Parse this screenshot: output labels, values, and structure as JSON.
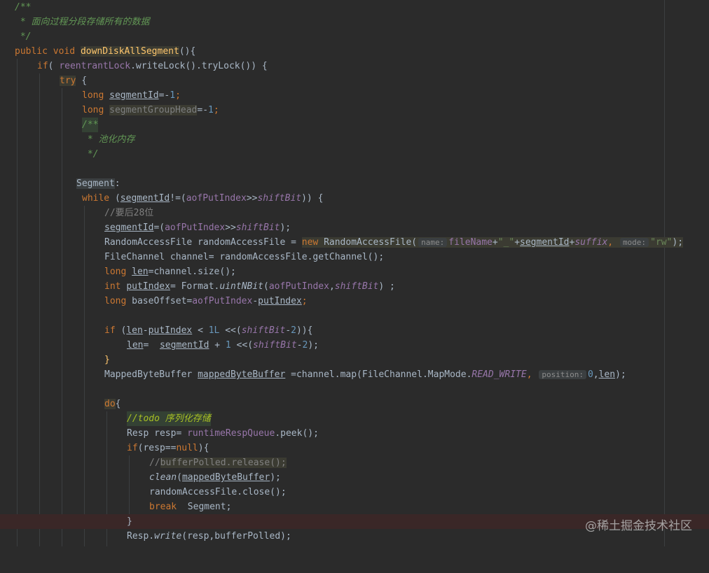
{
  "lines": {
    "l1": "/**",
    "l2": " * 面向过程分段存储所有的数据",
    "l3": " */",
    "l4_kw1": "public",
    "l4_kw2": "void",
    "l4_fn": "downDiskAllSegment",
    "l4_rest": "(){",
    "l5_kw": "if",
    "l5_a": "( ",
    "l5_field": "reentrantLock",
    "l5_b": ".writeLock().tryLock()) {",
    "l6_kw": "try",
    "l6_b": " {",
    "l7_kw": "long",
    "l7_var": "segmentId",
    "l7_eq": "=-",
    "l7_num": "1",
    "l7_end": ";",
    "l8_kw": "long",
    "l8_var": "segmentGroupHead",
    "l8_eq": "=-",
    "l8_num": "1",
    "l8_end": ";",
    "l9": "/**",
    "l10": " * 池化内存",
    "l11": " */",
    "l13_label": "Segment",
    "l13_colon": ":",
    "l14_kw": "while",
    "l14_a": " (",
    "l14_var": "segmentId",
    "l14_b": "!=(",
    "l14_field": "aofPutIndex",
    "l14_c": ">>",
    "l14_sfield": "shiftBit",
    "l14_d": ")) {",
    "l15": "//要后28位",
    "l16_var": "segmentId",
    "l16_a": "=(",
    "l16_field": "aofPutIndex",
    "l16_b": ">>",
    "l16_sfield": "shiftBit",
    "l16_c": ");",
    "l17_a": "RandomAccessFile randomAccessFile = ",
    "l17_kw": "new",
    "l17_b": " RandomAccessFile(",
    "l17_hint1": "name:",
    "l17_field": "fileName",
    "l17_c": "+",
    "l17_str": "\"_\"",
    "l17_d": "+",
    "l17_var": "segmentId",
    "l17_e": "+",
    "l17_sfield": "suffix",
    "l17_f": ", ",
    "l17_hint2": "mode:",
    "l17_str2": "\"rw\"",
    "l17_g": ");",
    "l18": "FileChannel channel= randomAccessFile.getChannel();",
    "l19_kw": "long",
    "l19_var": "len",
    "l19_rest": "=channel.size();",
    "l20_kw": "int",
    "l20_var": "putIndex",
    "l20_a": "= Format.",
    "l20_static": "uintNBit",
    "l20_b": "(",
    "l20_field": "aofPutIndex",
    "l20_c": ",",
    "l20_sfield": "shiftBit",
    "l20_d": ") ;",
    "l21_kw": "long",
    "l21_a": " baseOffset=",
    "l21_field": "aofPutIndex",
    "l21_b": "-",
    "l21_var": "putIndex",
    "l21_c": ";",
    "l23_kw": "if",
    "l23_a": " (",
    "l23_var1": "len",
    "l23_b": "-",
    "l23_var2": "putIndex",
    "l23_c": " < ",
    "l23_num": "1L",
    "l23_d": " <<(",
    "l23_sfield": "shiftBit",
    "l23_e": "-",
    "l23_num2": "2",
    "l23_f": ")){",
    "l24_var": "len",
    "l24_a": "=  ",
    "l24_var2": "segmentId",
    "l24_b": " + ",
    "l24_num": "1",
    "l24_c": " <<(",
    "l24_sfield": "shiftBit",
    "l24_d": "-",
    "l24_num2": "2",
    "l24_e": ");",
    "l25": "}",
    "l26_a": "MappedByteBuffer ",
    "l26_var": "mappedByteBuffer",
    "l26_b": " =channel.map(FileChannel.MapMode.",
    "l26_sfield": "READ_WRITE",
    "l26_c": ", ",
    "l26_hint": "position:",
    "l26_num": "0",
    "l26_d": ",",
    "l26_var2": "len",
    "l26_e": ");",
    "l28_kw": "do",
    "l28_b": "{",
    "l29_a": "//",
    "l29_todo": "todo 序列化存储",
    "l30_a": "Resp resp= ",
    "l30_field": "runtimeRespQueue",
    "l30_b": ".peek();",
    "l31_kw": "if",
    "l31_a": "(resp==",
    "l31_kw2": "null",
    "l31_b": "){",
    "l32_a": "//",
    "l32_b": "bufferPolled.release();",
    "l33_static": "clean",
    "l33_a": "(",
    "l33_var": "mappedByteBuffer",
    "l33_b": ");",
    "l34": "randomAccessFile.close();",
    "l35_kw": "break",
    "l35_a": "  Segment;",
    "l36": "}",
    "l37_a": "Resp.",
    "l37_static": "write",
    "l37_b": "(resp,bufferPolled);"
  },
  "watermark": "@稀土掘金技术社区",
  "colors": {
    "background": "#2b2b2b",
    "keyword": "#cc7832",
    "function": "#ffc66d",
    "number": "#6897bb",
    "string": "#6a8759",
    "doc_comment": "#629755",
    "field": "#9876aa"
  }
}
